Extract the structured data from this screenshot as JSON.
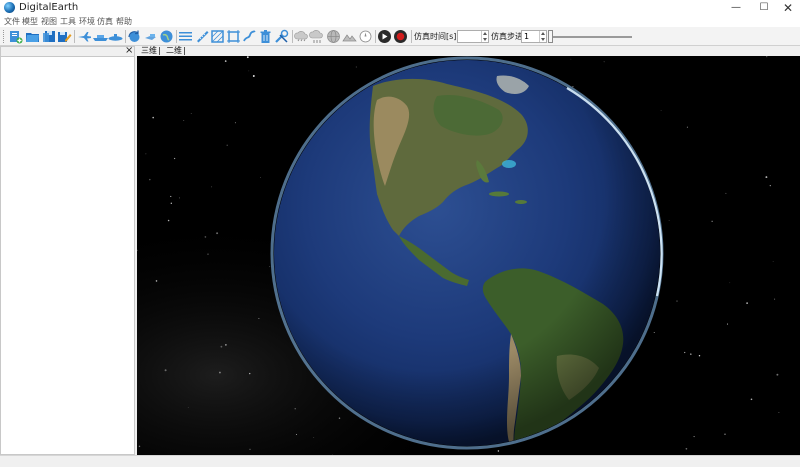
{
  "window": {
    "title": "DigitalEarth",
    "minimize_icon": "minimize-icon",
    "maximize_icon": "maximize-icon",
    "close_icon": "close-icon",
    "minimize_glyph": "—",
    "maximize_glyph": "☐",
    "close_glyph": "✕"
  },
  "menu": [
    "文件",
    "模型",
    "视图",
    "工具",
    "环境",
    "仿真",
    "帮助"
  ],
  "toolbar": {
    "icons": [
      "add-model-icon",
      "open-folder-icon",
      "save-icon",
      "save-as-icon",
      "aircraft-icon",
      "ship-icon",
      "submarine-icon",
      "globe-refresh-icon",
      "satellite-icon",
      "earth-icon",
      "grid-lines-icon",
      "ruler-icon",
      "area-icon",
      "frame-icon",
      "route-icon",
      "delete-icon",
      "tools-icon",
      "cloud-icon",
      "rain-icon",
      "sphere-icon",
      "terrain-icon",
      "compass-icon",
      "play-icon",
      "record-icon"
    ],
    "sim_time_label": "仿真时间[s]:",
    "sim_time_value": "",
    "sim_step_label": "仿真步进:",
    "sim_step_value": "1"
  },
  "left_panel": {
    "close_glyph": "×"
  },
  "tabs": [
    "三维",
    "二维"
  ],
  "colors": {
    "accent": "#3d8fd8",
    "record": "#d21c1c",
    "space": "#000000"
  }
}
